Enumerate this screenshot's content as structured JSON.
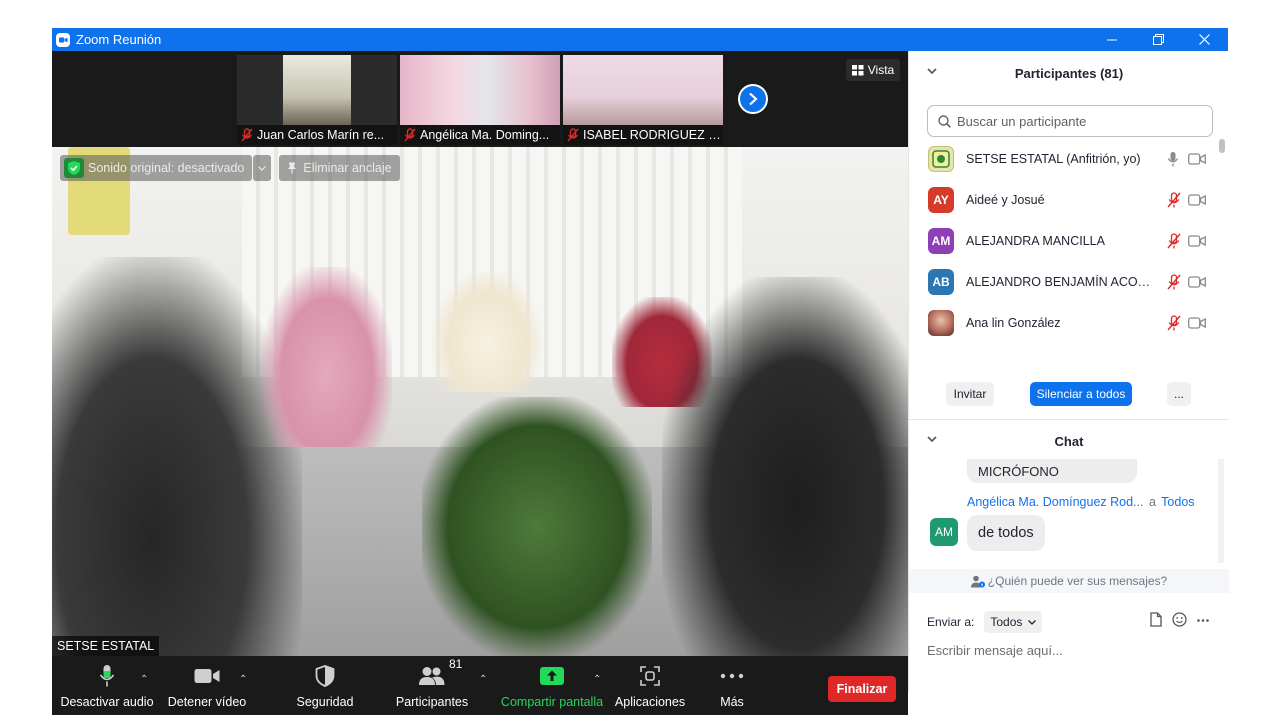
{
  "window": {
    "title": "Zoom Reunión",
    "minimize": "—",
    "restore": "❐",
    "close": "✕"
  },
  "filmstrip": {
    "tiles": [
      {
        "name": "Juan Carlos Marín re...",
        "muted": true
      },
      {
        "name": "Angélica Ma. Doming...",
        "muted": true
      },
      {
        "name": "ISABEL RODRIGUEZ C...",
        "muted": true
      }
    ],
    "view_label": "Vista"
  },
  "main_video": {
    "original_sound": "Sonido original: desactivado",
    "remove_pin": "Eliminar anclaje",
    "speaker_name": "SETSE ESTATAL"
  },
  "toolbar": {
    "mute_audio": "Desactivar audio",
    "stop_video": "Detener vídeo",
    "security": "Seguridad",
    "participants": "Participantes",
    "participants_count": "81",
    "share_screen": "Compartir pantalla",
    "apps": "Aplicaciones",
    "more": "Más",
    "end": "Finalizar"
  },
  "participants_panel": {
    "title": "Participantes (81)",
    "search_placeholder": "Buscar un participante",
    "participants": [
      {
        "name": "SETSE ESTATAL (Anfitrión, yo)",
        "initials": "",
        "mic": "on",
        "avatar_color": "#e9e3b0"
      },
      {
        "name": "Aideé y Josué",
        "initials": "AY",
        "mic": "muted",
        "avatar_color": "#d53a2b"
      },
      {
        "name": "ALEJANDRA MANCILLA",
        "initials": "AM",
        "mic": "muted",
        "avatar_color": "#8e3fb6"
      },
      {
        "name": "ALEJANDRO BENJAMÍN ACOST...",
        "initials": "AB",
        "mic": "muted",
        "avatar_color": "#2a77b3"
      },
      {
        "name": "Ana lin González",
        "initials": "",
        "mic": "muted",
        "avatar_color": "#b46a5c"
      }
    ],
    "invite_label": "Invitar",
    "mute_all_label": "Silenciar a todos",
    "more_label": "..."
  },
  "chat_panel": {
    "title": "Chat",
    "prev_message": "MICRÓFONO",
    "sender": "Angélica Ma. Domínguez Rod...",
    "to_word": "a",
    "recipient": "Todos",
    "sender_initials": "AM",
    "message": "de todos",
    "who_can_see": "¿Quién puede ver sus mensajes?",
    "send_to_label": "Enviar a:",
    "send_to_value": "Todos",
    "input_placeholder": "Escribir mensaje aquí..."
  },
  "colors": {
    "zoom_blue": "#0e72ed",
    "end_red": "#e02828",
    "muted_red": "#e02828",
    "share_green": "#23d959"
  }
}
